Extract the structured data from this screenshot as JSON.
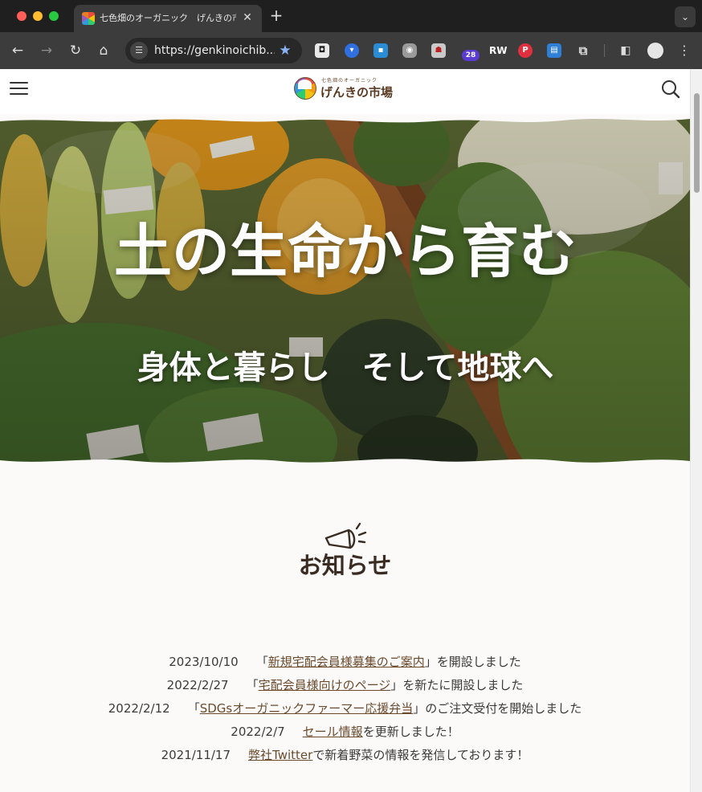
{
  "browser": {
    "tab_title": "七色畑のオーガニック　げんきの市場",
    "url": "https://genkinoichib...",
    "extension_badge": "28",
    "extension_letters": "RW"
  },
  "site": {
    "logo_sub": "七色畑のオーガニック",
    "logo_main": "げんきの市場"
  },
  "hero": {
    "title": "土の生命から育む",
    "subtitle": "身体と暮らし　そして地球へ"
  },
  "news": {
    "heading": "お知らせ",
    "items": [
      {
        "date": "2023/10/10",
        "prefix": "「",
        "link": "新規宅配会員様募集のご案内",
        "suffix": "」を開設しました"
      },
      {
        "date": "2022/2/27",
        "prefix": "「",
        "link": "宅配会員様向けのページ",
        "suffix": "」を新たに開設しました"
      },
      {
        "date": "2022/2/12",
        "prefix": "「",
        "link": "SDGsオーガニックファーマー応援弁当",
        "suffix": "」のご注文受付を開始しました"
      },
      {
        "date": "2022/2/7",
        "prefix": "",
        "link": "セール情報",
        "suffix": "を更新しました！"
      },
      {
        "date": "2021/11/17",
        "prefix": "",
        "link": "弊社Twitter",
        "suffix": "で新着野菜の情報を発信しております！"
      }
    ]
  }
}
